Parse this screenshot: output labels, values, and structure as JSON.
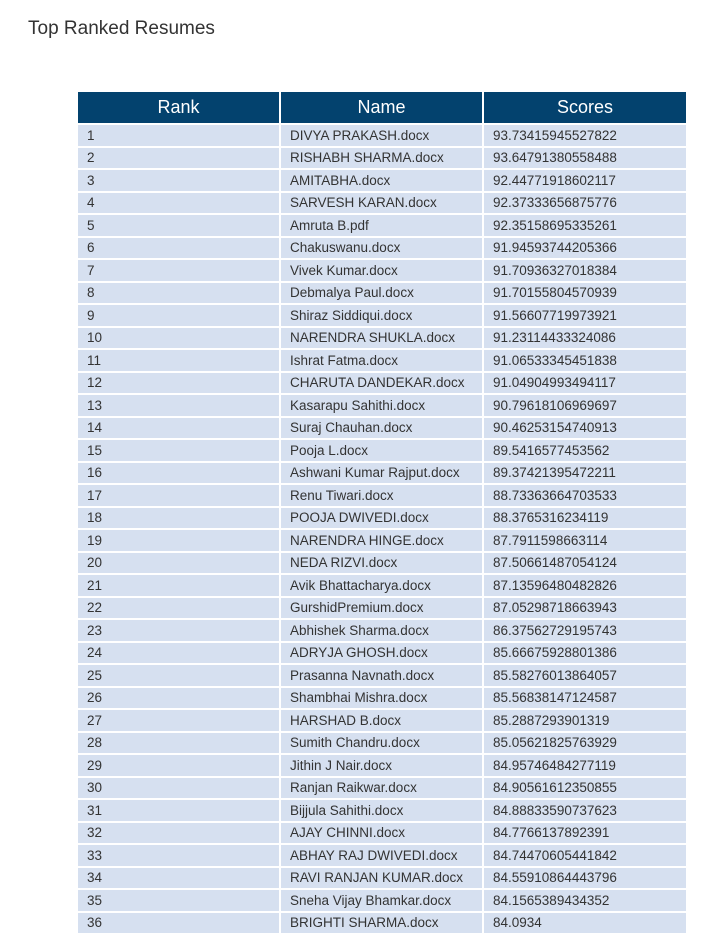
{
  "page": {
    "title": "Top Ranked Resumes"
  },
  "table": {
    "headers": [
      "Rank",
      "Name",
      "Scores"
    ],
    "rows": [
      {
        "rank": "1",
        "name": "DIVYA PRAKASH.docx",
        "score": "93.73415945527822"
      },
      {
        "rank": "2",
        "name": "RISHABH SHARMA.docx",
        "score": "93.64791380558488"
      },
      {
        "rank": "3",
        "name": "AMITABHA.docx",
        "score": "92.44771918602117"
      },
      {
        "rank": "4",
        "name": "SARVESH KARAN.docx",
        "score": "92.37333656875776"
      },
      {
        "rank": "5",
        "name": "Amruta B.pdf",
        "score": "92.35158695335261"
      },
      {
        "rank": "6",
        "name": "Chakuswanu.docx",
        "score": "91.94593744205366"
      },
      {
        "rank": "7",
        "name": "Vivek Kumar.docx",
        "score": "91.70936327018384"
      },
      {
        "rank": "8",
        "name": "Debmalya Paul.docx",
        "score": "91.70155804570939"
      },
      {
        "rank": "9",
        "name": "Shiraz Siddiqui.docx",
        "score": "91.56607719973921"
      },
      {
        "rank": "10",
        "name": "NARENDRA SHUKLA.docx",
        "score": "91.23114433324086"
      },
      {
        "rank": "11",
        "name": "Ishrat Fatma.docx",
        "score": "91.06533345451838"
      },
      {
        "rank": "12",
        "name": "CHARUTA DANDEKAR.docx",
        "score": "91.04904993494117"
      },
      {
        "rank": "13",
        "name": "Kasarapu Sahithi.docx",
        "score": "90.79618106969697"
      },
      {
        "rank": "14",
        "name": "Suraj Chauhan.docx",
        "score": "90.46253154740913"
      },
      {
        "rank": "15",
        "name": "Pooja L.docx",
        "score": "89.5416577453562"
      },
      {
        "rank": "16",
        "name": "Ashwani Kumar Rajput.docx",
        "score": "89.37421395472211"
      },
      {
        "rank": "17",
        "name": "Renu Tiwari.docx",
        "score": "88.73363664703533"
      },
      {
        "rank": "18",
        "name": "POOJA DWIVEDI.docx",
        "score": "88.3765316234119"
      },
      {
        "rank": "19",
        "name": "NARENDRA HINGE.docx",
        "score": "87.7911598663114"
      },
      {
        "rank": "20",
        "name": "NEDA RIZVI.docx",
        "score": "87.50661487054124"
      },
      {
        "rank": "21",
        "name": "Avik Bhattacharya.docx",
        "score": "87.13596480482826"
      },
      {
        "rank": "22",
        "name": "GurshidPremium.docx",
        "score": "87.05298718663943"
      },
      {
        "rank": "23",
        "name": "Abhishek Sharma.docx",
        "score": "86.37562729195743"
      },
      {
        "rank": "24",
        "name": "ADRYJA GHOSH.docx",
        "score": "85.66675928801386"
      },
      {
        "rank": "25",
        "name": "Prasanna Navnath.docx",
        "score": "85.58276013864057"
      },
      {
        "rank": "26",
        "name": "Shambhai Mishra.docx",
        "score": "85.56838147124587"
      },
      {
        "rank": "27",
        "name": "HARSHAD B.docx",
        "score": "85.2887293901319"
      },
      {
        "rank": "28",
        "name": "Sumith Chandru.docx",
        "score": "85.05621825763929"
      },
      {
        "rank": "29",
        "name": "Jithin J Nair.docx",
        "score": "84.95746484277119"
      },
      {
        "rank": "30",
        "name": "Ranjan Raikwar.docx",
        "score": "84.90561612350855"
      },
      {
        "rank": "31",
        "name": "Bijjula Sahithi.docx",
        "score": "84.88833590737623"
      },
      {
        "rank": "32",
        "name": "AJAY CHINNI.docx",
        "score": "84.7766137892391"
      },
      {
        "rank": "33",
        "name": "ABHAY RAJ DWIVEDI.docx",
        "score": "84.74470605441842"
      },
      {
        "rank": "34",
        "name": "RAVI RANJAN KUMAR.docx",
        "score": "84.55910864443796"
      },
      {
        "rank": "35",
        "name": "Sneha Vijay Bhamkar.docx",
        "score": "84.1565389434352"
      },
      {
        "rank": "36",
        "name": "BRIGHTI SHARMA.docx",
        "score": "84.0934"
      }
    ]
  },
  "colors": {
    "header_bg": "#03426e",
    "header_text": "#ffffff",
    "row_bg": "#d6e0f0",
    "row_text": "#333333",
    "border": "#ffffff"
  }
}
